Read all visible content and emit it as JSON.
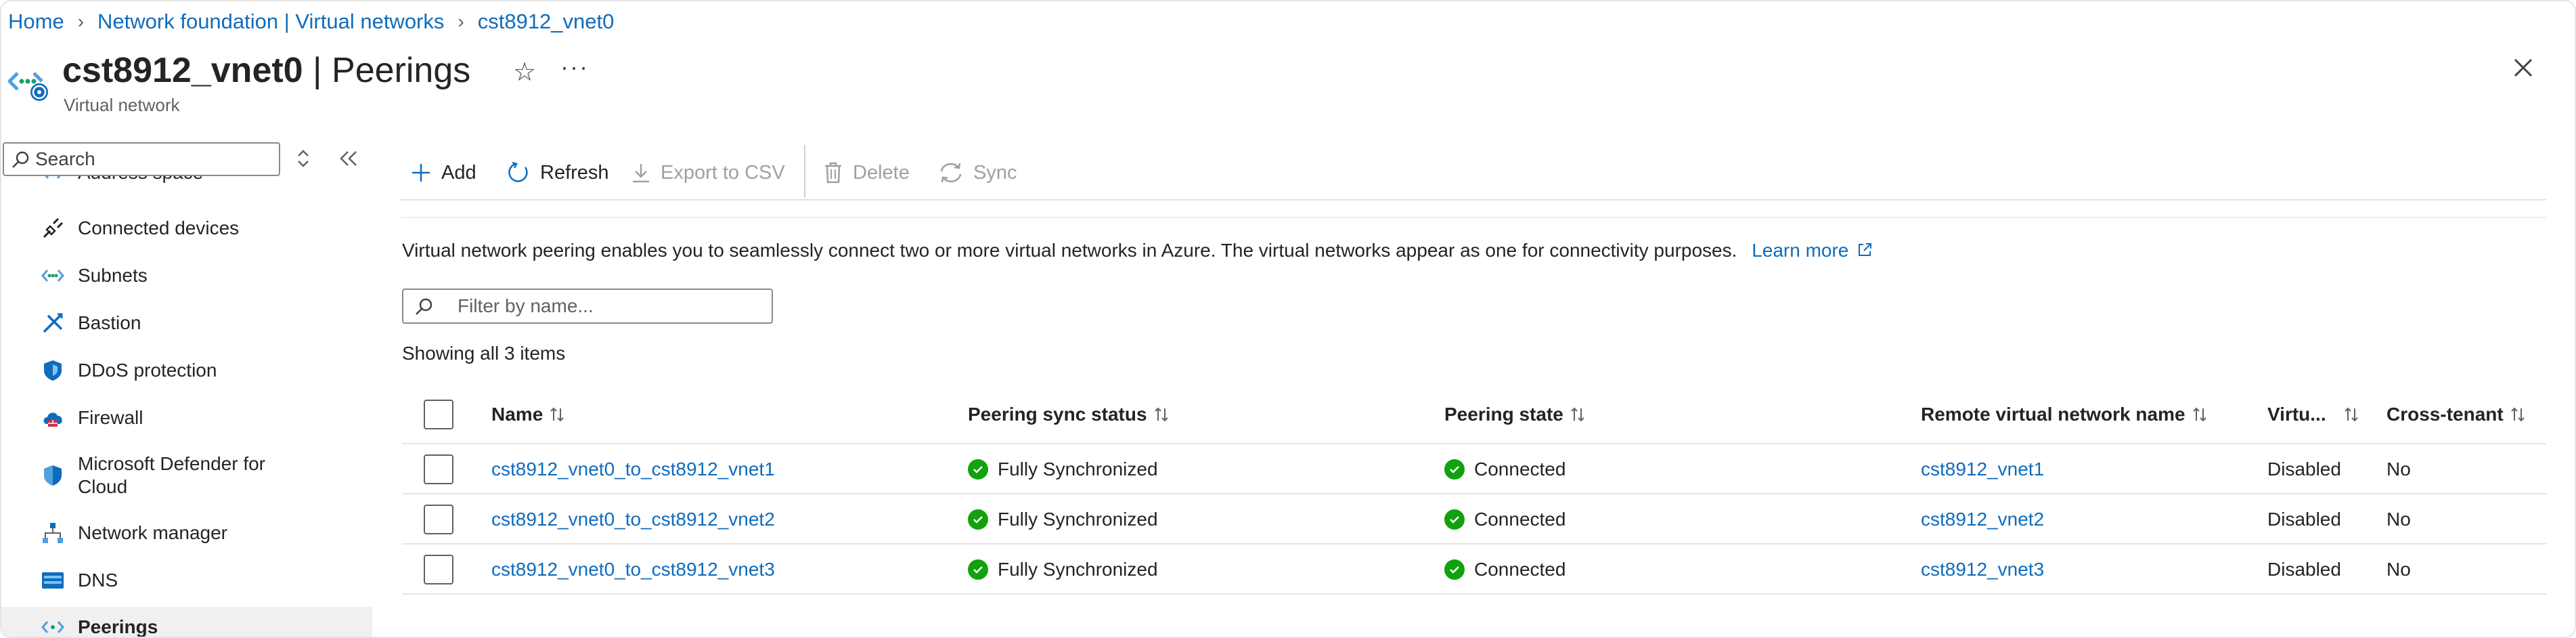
{
  "breadcrumb": [
    "Home",
    "Network foundation | Virtual networks",
    "cst8912_vnet0"
  ],
  "title": {
    "resource": "cst8912_vnet0",
    "section": " | Peerings",
    "subtitle": "Virtual network"
  },
  "nav": {
    "search_placeholder": "Search",
    "items": [
      {
        "label": "Address space",
        "icon": "address-space-icon"
      },
      {
        "label": "Connected devices",
        "icon": "plug-icon"
      },
      {
        "label": "Subnets",
        "icon": "subnets-icon"
      },
      {
        "label": "Bastion",
        "icon": "bastion-icon"
      },
      {
        "label": "DDoS protection",
        "icon": "shield-icon"
      },
      {
        "label": "Firewall",
        "icon": "firewall-icon"
      },
      {
        "label": "Microsoft Defender for Cloud",
        "icon": "defender-icon"
      },
      {
        "label": "Network manager",
        "icon": "network-manager-icon"
      },
      {
        "label": "DNS",
        "icon": "dns-icon"
      },
      {
        "label": "Peerings",
        "icon": "peerings-icon"
      }
    ]
  },
  "toolbar": {
    "add": "Add",
    "refresh": "Refresh",
    "export": "Export to CSV",
    "delete": "Delete",
    "sync": "Sync"
  },
  "intro": {
    "text": "Virtual network peering enables you to seamlessly connect two or more virtual networks in Azure. The virtual networks appear as one for connectivity purposes.",
    "learn_more": "Learn more"
  },
  "filter_placeholder": "Filter by name...",
  "showing": "Showing all 3 items",
  "table": {
    "columns": [
      "Name",
      "Peering sync status",
      "Peering state",
      "Remote virtual network name",
      "Virtu...",
      "Cross-tenant"
    ],
    "rows": [
      [
        "cst8912_vnet0_to_cst8912_vnet1",
        "Fully Synchronized",
        "Connected",
        "cst8912_vnet1",
        "Disabled",
        "No"
      ],
      [
        "cst8912_vnet0_to_cst8912_vnet2",
        "Fully Synchronized",
        "Connected",
        "cst8912_vnet2",
        "Disabled",
        "No"
      ],
      [
        "cst8912_vnet0_to_cst8912_vnet3",
        "Fully Synchronized",
        "Connected",
        "cst8912_vnet3",
        "Disabled",
        "No"
      ]
    ]
  },
  "colors": {
    "link": "#0f6cbd",
    "success": "#13a10e",
    "text": "#242424"
  }
}
